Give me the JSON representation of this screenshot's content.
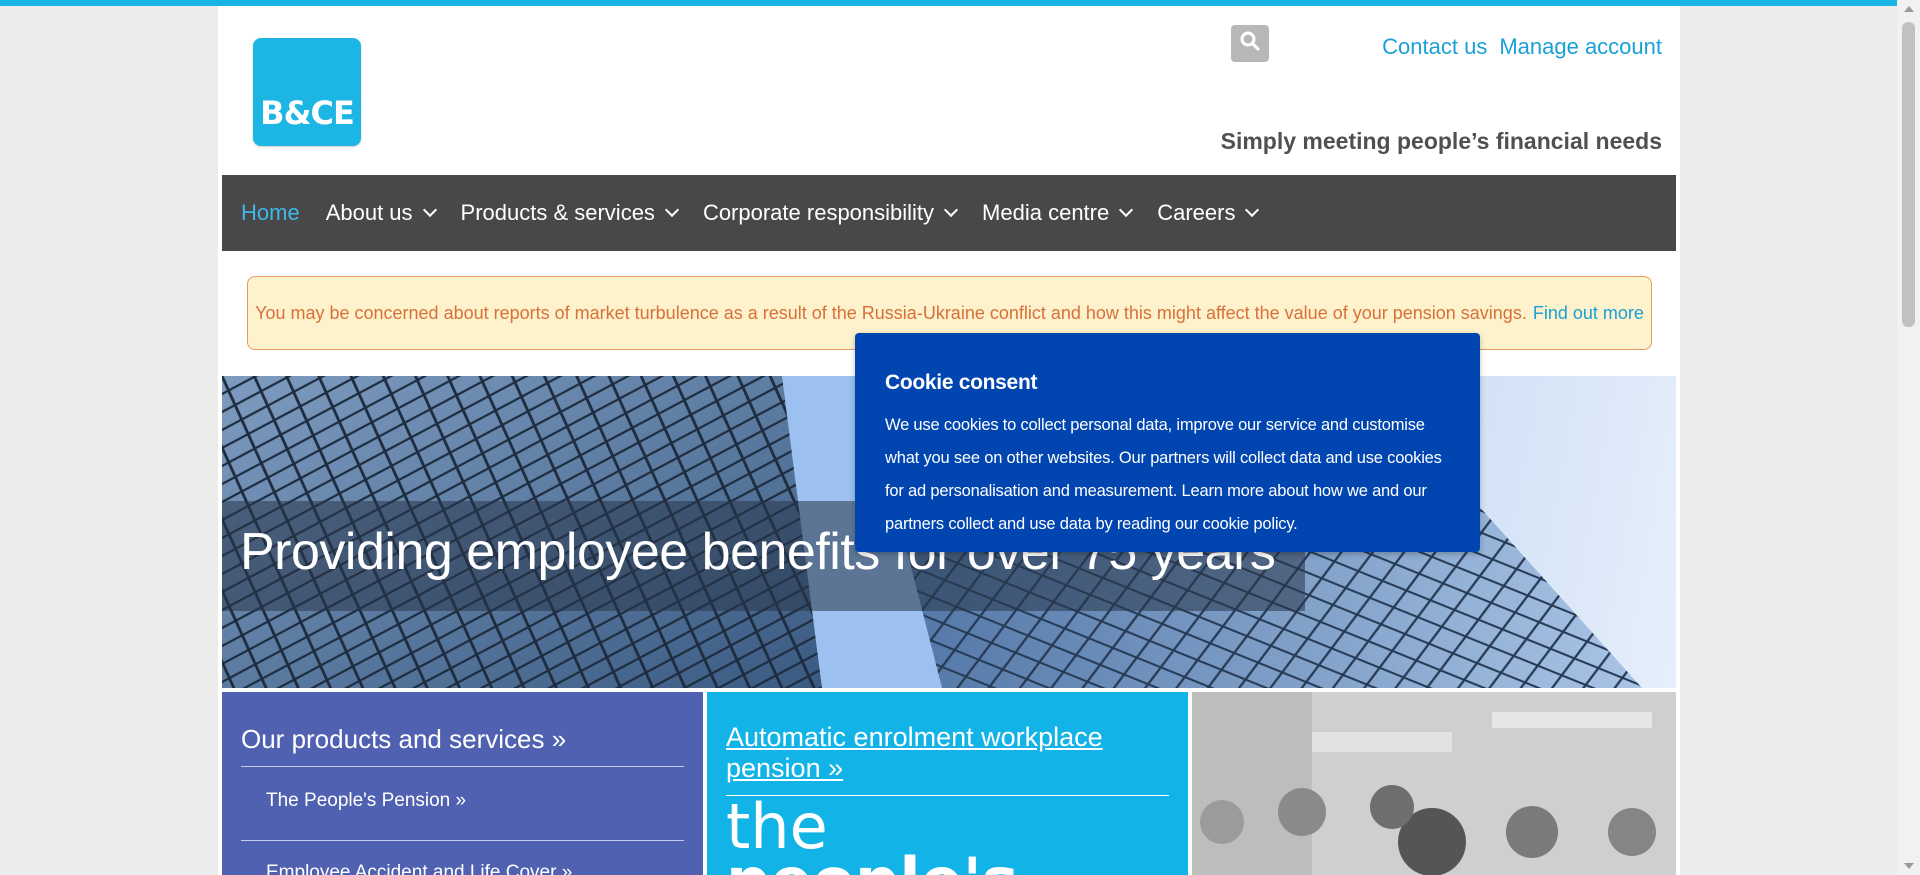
{
  "header": {
    "logo_text": "B&CE",
    "search_icon": "search-icon",
    "links": [
      "Contact us",
      "Manage account"
    ],
    "tagline": "Simply meeting people’s financial needs"
  },
  "nav": {
    "items": [
      {
        "label": "Home",
        "active": true,
        "dropdown": false
      },
      {
        "label": "About us",
        "active": false,
        "dropdown": true
      },
      {
        "label": "Products & services",
        "active": false,
        "dropdown": true
      },
      {
        "label": "Corporate responsibility",
        "active": false,
        "dropdown": true
      },
      {
        "label": "Media centre",
        "active": false,
        "dropdown": true
      },
      {
        "label": "Careers",
        "active": false,
        "dropdown": true
      }
    ]
  },
  "alert": {
    "text": "You may be concerned about reports of market turbulence as a result of the Russia-Ukraine conflict and how this might affect the value of your pension savings.",
    "link": "Find out more"
  },
  "hero": {
    "title": "Providing employee benefits for over 75 years"
  },
  "tiles": {
    "products": {
      "title": "Our products and services »",
      "links": [
        "The People's Pension »",
        "Employee Accident and Life Cover »"
      ]
    },
    "enrolment": {
      "title": "Automatic enrolment workplace pension »",
      "brand_line1": "the",
      "brand_line2": "people's"
    }
  },
  "cookie": {
    "title": "Cookie consent",
    "text": "We use cookies to collect personal data, improve our service and customise what you see on other websites. Our partners will collect data and use cookies for ad personalisation and measurement. Learn more about how we and our partners collect and use data by reading our cookie policy."
  },
  "colors": {
    "accent": "#19b4e5",
    "nav_bg": "#484848",
    "cookie_bg": "#0045b0",
    "tile_purple": "#5161b1",
    "alert_bg": "#fdf2cc"
  }
}
